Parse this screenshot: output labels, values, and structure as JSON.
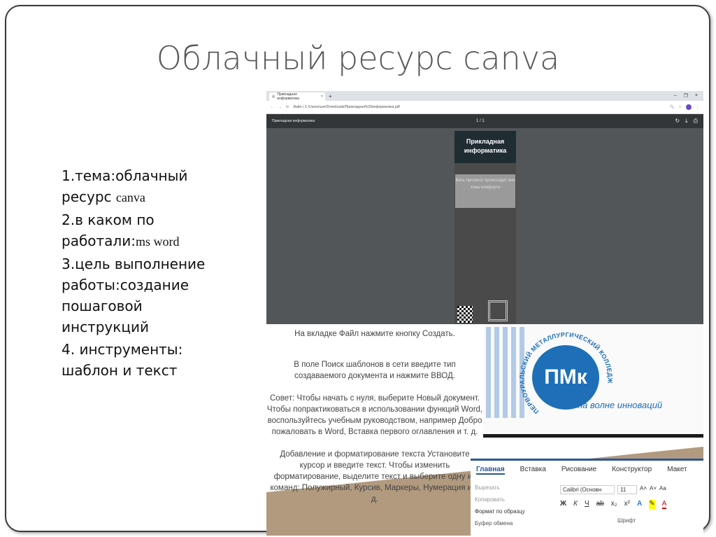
{
  "slide": {
    "title": "Облачный ресурс canva",
    "items": [
      {
        "main": "1.тема:облачный ресурс ",
        "small": "canva"
      },
      {
        "main": "2.в каком по работали:",
        "small": "ms word"
      },
      {
        "main": "3.цель выполнение работы:создание пошаговой инструкций",
        "small": ""
      },
      {
        "main": "4. инструменты: шаблон и текст",
        "small": ""
      }
    ]
  },
  "browser": {
    "tab_title": "Прикладная информатика",
    "url": "Файл | C:/Users/user/Downloads/Прикладная%20информатика.pdf",
    "pdf_title": "Прикладная информатика",
    "page_indicator": "1 / 1"
  },
  "pdf_page": {
    "heading": "Прикладная информатика",
    "quote": "Весь прогресс происходит вне зоны комфорта"
  },
  "document": {
    "lines": [
      "На вкладке Файл нажмите кнопку Создать.",
      "В поле Поиск шаблонов в сети введите тип создаваемого документа и нажмите ВВОД.",
      "Совет: Чтобы начать с нуля, выберите Новый документ. Чтобы попрактиковаться в использовании функций Word, воспользуйтесь учебным руководством, например Добро пожаловать в Word, Вставка первого оглавления и т. д.",
      "Добавление и форматирование текста Установите курсор и введите текст. Чтобы изменить форматирование, выделите текст и выберите одну из команд: Полужирный, Курсив, Маркеры, Нумерация и т. д."
    ]
  },
  "desktop": {
    "logo": "ПМк",
    "arc_text": "ПЕРВОУРАЛЬСКИЙ МЕТАЛЛУРГИЧЕСКИЙ КОЛЛЕДЖ",
    "tagline": "на волне инноваций"
  },
  "ribbon": {
    "tabs": [
      "Главная",
      "Вставка",
      "Рисование",
      "Конструктор",
      "Макет"
    ],
    "cut": "Вырезать",
    "copy": "Копировать",
    "format_painter": "Формат по образцу",
    "clipboard_group": "Буфер обмена",
    "font": "Calibri (Основн",
    "size": "11",
    "font_group": "Шрифт",
    "bold": "Ж",
    "italic": "К",
    "underline": "Ч"
  }
}
